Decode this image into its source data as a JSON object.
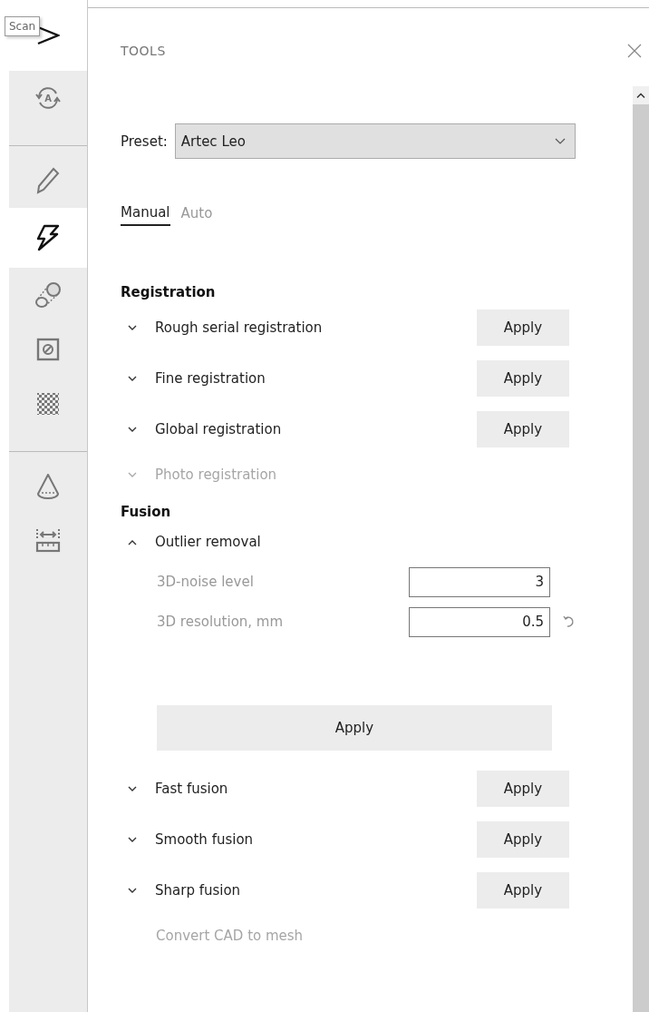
{
  "sidebar": {
    "tooltip": "Scan",
    "groups": [
      [
        {
          "kind": "scan",
          "selected": false
        },
        {
          "kind": "autopilot",
          "selected": false,
          "letter": "A"
        }
      ],
      [
        {
          "kind": "edit",
          "selected": false
        },
        {
          "kind": "tools",
          "selected": true
        },
        {
          "kind": "align",
          "selected": false
        },
        {
          "kind": "erase",
          "selected": false
        },
        {
          "kind": "texture",
          "selected": false
        }
      ],
      [
        {
          "kind": "cone",
          "selected": false
        },
        {
          "kind": "measure",
          "selected": false
        }
      ]
    ]
  },
  "panel": {
    "title": "TOOLS",
    "preset": {
      "label": "Preset:",
      "value": "Artec Leo"
    },
    "tabs": [
      {
        "label": "Manual",
        "selected": true
      },
      {
        "label": "Auto",
        "selected": false
      }
    ],
    "sections": [
      {
        "title": "Registration",
        "items": [
          {
            "label": "Rough serial registration",
            "kind": "collapsible",
            "expanded": false,
            "disabled": false,
            "button": "Apply"
          },
          {
            "label": "Fine registration",
            "kind": "collapsible",
            "expanded": false,
            "disabled": false,
            "button": "Apply"
          },
          {
            "label": "Global registration",
            "kind": "collapsible",
            "expanded": false,
            "disabled": false,
            "button": "Apply"
          },
          {
            "label": "Photo registration",
            "kind": "collapsible",
            "expanded": false,
            "disabled": true
          }
        ]
      },
      {
        "title": "Fusion",
        "items": [
          {
            "label": "Outlier removal",
            "kind": "collapsible",
            "expanded": true,
            "disabled": false,
            "fields": [
              {
                "label": "3D-noise level",
                "value": "3",
                "kind": "plain"
              },
              {
                "label": "3D resolution, mm",
                "value": "0.5",
                "kind": "resettable"
              }
            ],
            "wide_button": "Apply"
          },
          {
            "label": "Fast fusion",
            "kind": "collapsible",
            "expanded": false,
            "disabled": false,
            "button": "Apply"
          },
          {
            "label": "Smooth fusion",
            "kind": "collapsible",
            "expanded": false,
            "disabled": false,
            "button": "Apply"
          },
          {
            "label": "Sharp fusion",
            "kind": "collapsible",
            "expanded": false,
            "disabled": false,
            "button": "Apply"
          },
          {
            "label": "Convert CAD to mesh",
            "kind": "plain",
            "disabled": true
          }
        ]
      }
    ]
  }
}
